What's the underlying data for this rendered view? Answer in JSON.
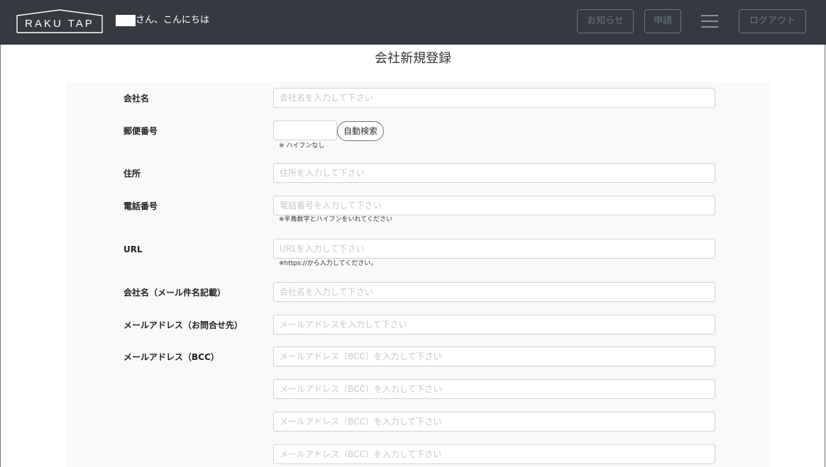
{
  "header": {
    "logo_text": "RAKU TAP",
    "greeting": "さん、こんにちは",
    "notice_button": "お知らせ",
    "apply_button": "申請",
    "logout_button": "ログアウト"
  },
  "page": {
    "title": "会社新規登録"
  },
  "form": {
    "company_name": {
      "label": "会社名",
      "placeholder": "会社名を入力して下さい"
    },
    "postal_code": {
      "label": "郵便番号",
      "search_button": "自動検索",
      "help": "※ ハイフンなし"
    },
    "address": {
      "label": "住所",
      "placeholder": "住所を入力して下さい"
    },
    "phone": {
      "label": "電話番号",
      "placeholder": "電話番号を入力して下さい",
      "help": "※半角数字とハイフンをいれてください"
    },
    "url": {
      "label": "URL",
      "placeholder": "URLを入力して下さい",
      "help": "※https://から入力してください。"
    },
    "mail_company_name": {
      "label": "会社名（メール件名記載）",
      "placeholder": "会社名を入力して下さい"
    },
    "contact_email": {
      "label": "メールアドレス（お問合せ先）",
      "placeholder": "メールアドレスを入力して下さい"
    },
    "bcc": {
      "label": "メールアドレス（BCC）",
      "placeholders": [
        "メールアドレス（BCC）を入力して下さい",
        "メールアドレス（BCC）を入力して下さい",
        "メールアドレス（BCC）を入力して下さい",
        "メールアドレス（BCC）を入力して下さい"
      ]
    }
  },
  "colors": {
    "navbar": "#343a40",
    "panel": "#f8f9fa",
    "nav_button_border": "#6c757d"
  },
  "icons": {
    "menu": "hamburger-icon",
    "logo": "house-logo-icon"
  }
}
